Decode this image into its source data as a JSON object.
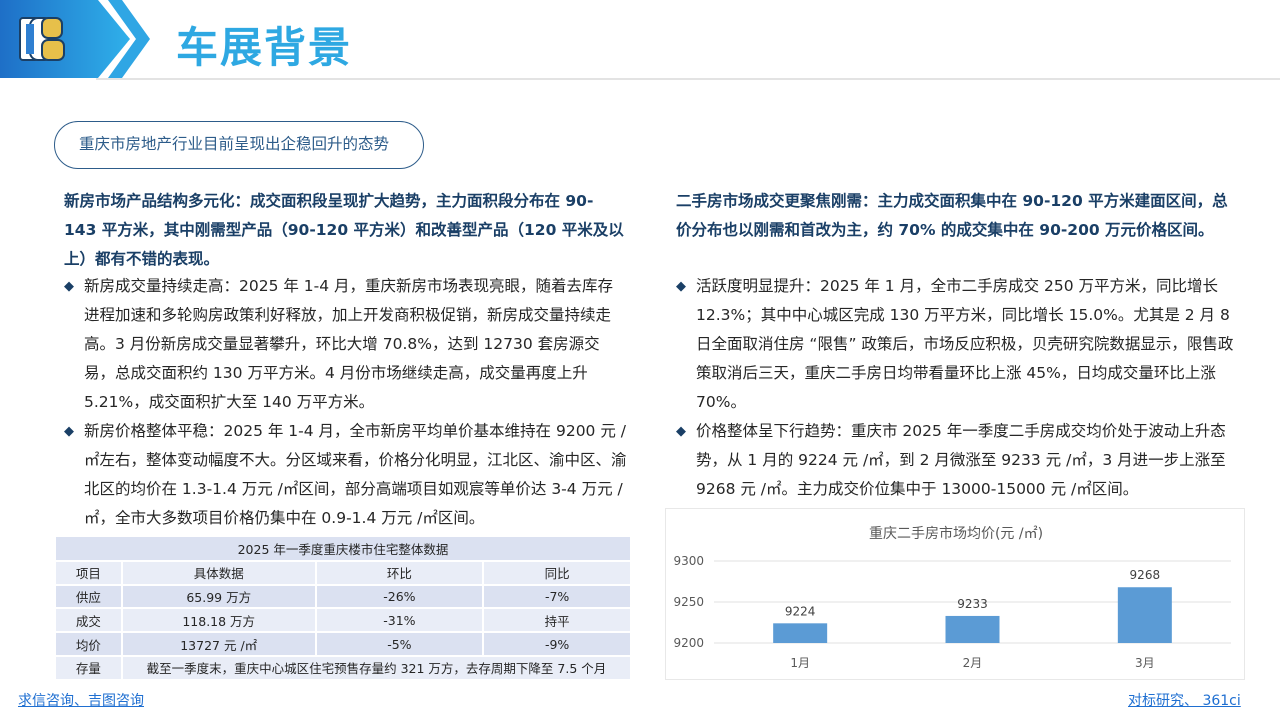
{
  "header": {
    "title": "车展背景"
  },
  "pill": {
    "label": "重庆市房地产行业目前呈现出企稳回升的态势"
  },
  "left": {
    "lead": "新房市场产品结构多元化：成交面积段呈现扩大趋势，主力面积段分布在 90-143 平方米，其中刚需型产品（90-120 平方米）和改善型产品（120 平米及以上）都有不错的表现。",
    "bullets": [
      "新房成交量持续走高：2025 年 1-4 月，重庆新房市场表现亮眼，随着去库存进程加速和多轮购房政策利好释放，加上开发商积极促销，新房成交量持续走高。3 月份新房成交量显著攀升，环比大增 70.8%，达到 12730 套房源交易，总成交面积约 130 万平方米。4 月份市场继续走高，成交量再度上升 5.21%，成交面积扩大至 140 万平方米。",
      "新房价格整体平稳：2025 年 1-4 月，全市新房平均单价基本维持在 9200 元 /㎡左右，整体变动幅度不大。分区域来看，价格分化明显，江北区、渝中区、渝北区的均价在 1.3-1.4 万元 /㎡区间，部分高端项目如观宸等单价达 3-4 万元 /㎡，全市大多数项目价格仍集中在 0.9-1.4 万元 /㎡区间。"
    ]
  },
  "right": {
    "lead": "二手房市场成交更聚焦刚需：主力成交面积集中在 90-120 平方米建面区间，总价分布也以刚需和首改为主，约 70% 的成交集中在 90-200 万元价格区间。",
    "bullets": [
      "活跃度明显提升：2025 年 1 月，全市二手房成交 250 万平方米，同比增长 12.3%；其中中心城区完成 130 万平方米，同比增长 15.0%。尤其是 2 月 8 日全面取消住房 “限售” 政策后，市场反应积极，贝壳研究院数据显示，限售政策取消后三天，重庆二手房日均带看量环比上涨 45%，日均成交量环比上涨 70%。",
      "价格整体呈下行趋势：重庆市 2025 年一季度二手房成交均价处于波动上升态势，从 1 月的 9224 元 /㎡，到 2 月微涨至 9233 元 /㎡，3 月进一步上涨至 9268 元 /㎡。主力成交价位集中于 13000-15000 元 /㎡区间。"
    ]
  },
  "table": {
    "caption": "2025 年一季度重庆楼市住宅整体数据",
    "headers": [
      "项目",
      "具体数据",
      "环比",
      "同比"
    ],
    "rows": [
      [
        "供应",
        "65.99 万方",
        "-26%",
        "-7%"
      ],
      [
        "成交",
        "118.18 万方",
        "-31%",
        "持平"
      ],
      [
        "均价",
        "13727 元 /㎡",
        "-5%",
        "-9%"
      ]
    ],
    "last_row": {
      "label": "存量",
      "text": "截至一季度末，重庆中心城区住宅预售存量约 321 万方，去存周期下降至 7.5 个月"
    }
  },
  "chart_data": {
    "type": "bar",
    "title": "重庆二手房市场均价(元 /㎡)",
    "categories": [
      "1月",
      "2月",
      "3月"
    ],
    "values": [
      9224,
      9233,
      9268
    ],
    "ylim": [
      9200,
      9300
    ],
    "yticks": [
      9200,
      9250,
      9300
    ],
    "grid": true,
    "bar_color": "#5b9bd5"
  },
  "footer": {
    "left": "求信咨询、吉图咨询",
    "right": "对标研究、 361ci"
  },
  "colors": {
    "accent": "#2ea8e2",
    "navy": "#1a3f66",
    "link": "#1f6fd1"
  }
}
